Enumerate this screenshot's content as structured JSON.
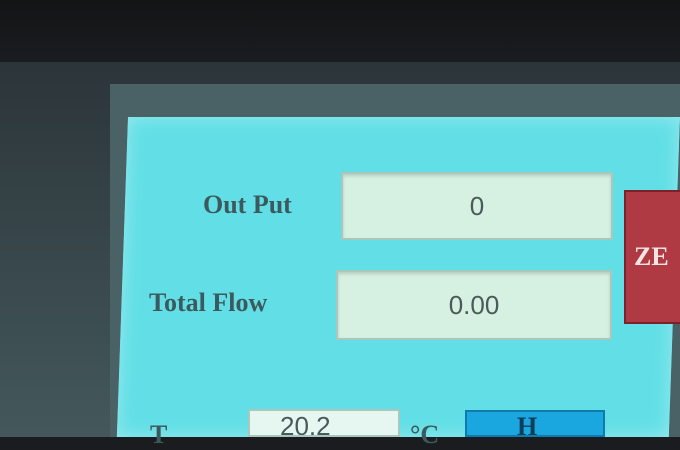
{
  "panel": {
    "output": {
      "label": "Out Put",
      "value": "0"
    },
    "total_flow": {
      "label": "Total Flow",
      "value": "0.00"
    },
    "zero_button": {
      "label": "ZE"
    },
    "bottom_row": {
      "label_partial": "T",
      "value_partial": "20.2",
      "unit": "°C",
      "button_partial": "H"
    }
  },
  "colors": {
    "screen": "#62dfe6",
    "field": "#d6f0e2",
    "zero_button": "#b03a44",
    "blue_button": "#1aa7e0"
  }
}
